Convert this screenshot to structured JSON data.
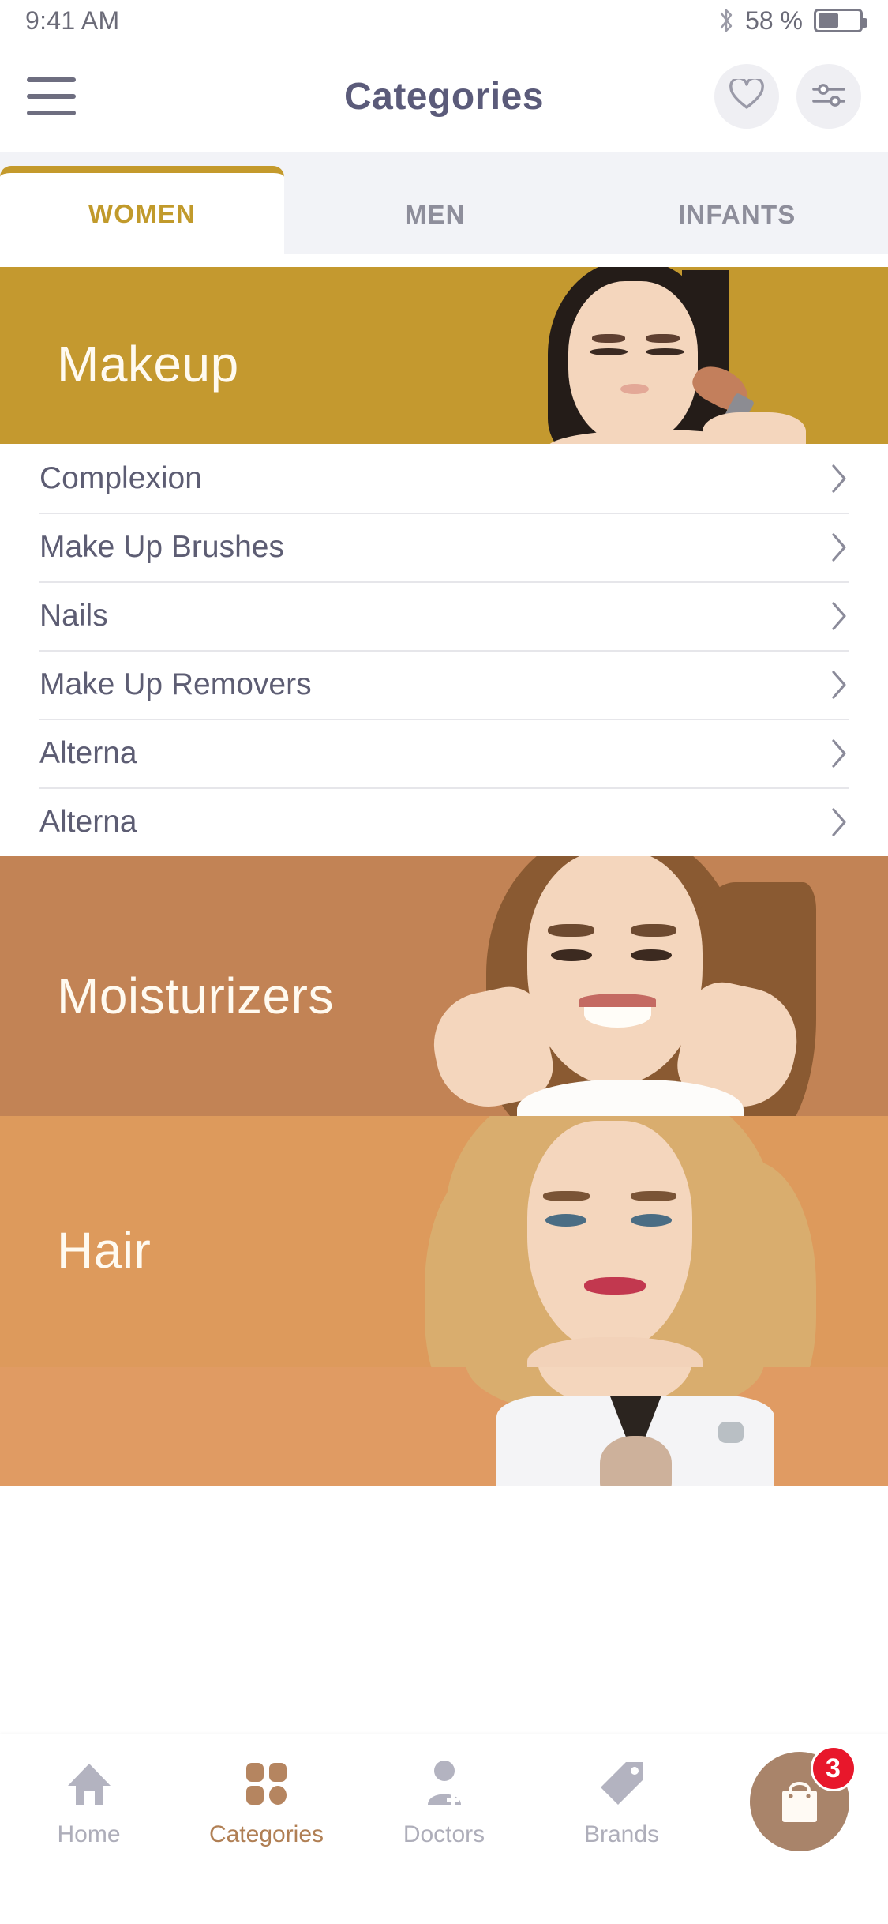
{
  "status_bar": {
    "time": "9:41 AM",
    "battery_percent": "58 %",
    "bluetooth_icon": "bluetooth-icon",
    "battery_icon": "battery-icon",
    "battery_level": 50
  },
  "header": {
    "title": "Categories",
    "menu_icon": "hamburger-menu-icon",
    "favorites_icon": "heart-icon",
    "filter_icon": "sliders-filter-icon"
  },
  "tabs": {
    "items": [
      {
        "label": "WOMEN",
        "active": true
      },
      {
        "label": "MEN",
        "active": false
      },
      {
        "label": "INFANTS",
        "active": false
      }
    ],
    "active_color": "#c19a2b",
    "inactive_color": "#8e8e9b"
  },
  "banners": {
    "makeup": {
      "title": "Makeup",
      "color": "#c4992f"
    },
    "moisturizers": {
      "title": "Moisturizers",
      "color": "#c28355"
    },
    "hair": {
      "title": "Hair",
      "color": "#dd9a5c"
    },
    "partial": {
      "title": "",
      "color": "#e09b63"
    }
  },
  "category_list": {
    "chevron_icon": "chevron-right-icon",
    "items": [
      {
        "label": "Complexion"
      },
      {
        "label": "Make Up Brushes"
      },
      {
        "label": "Nails"
      },
      {
        "label": "Make Up Removers"
      },
      {
        "label": "Alterna"
      },
      {
        "label": "Alterna"
      }
    ]
  },
  "bottom_nav": {
    "items": [
      {
        "label": "Home",
        "icon": "home-icon",
        "active": false
      },
      {
        "label": "Categories",
        "icon": "grid-icon",
        "active": true
      },
      {
        "label": "Doctors",
        "icon": "doctor-icon",
        "active": false
      },
      {
        "label": "Brands",
        "icon": "tag-icon",
        "active": false
      }
    ],
    "cart": {
      "icon": "shopping-bag-icon",
      "badge_count": "3",
      "button_color": "#a9846a",
      "badge_color": "#e8172b"
    }
  }
}
